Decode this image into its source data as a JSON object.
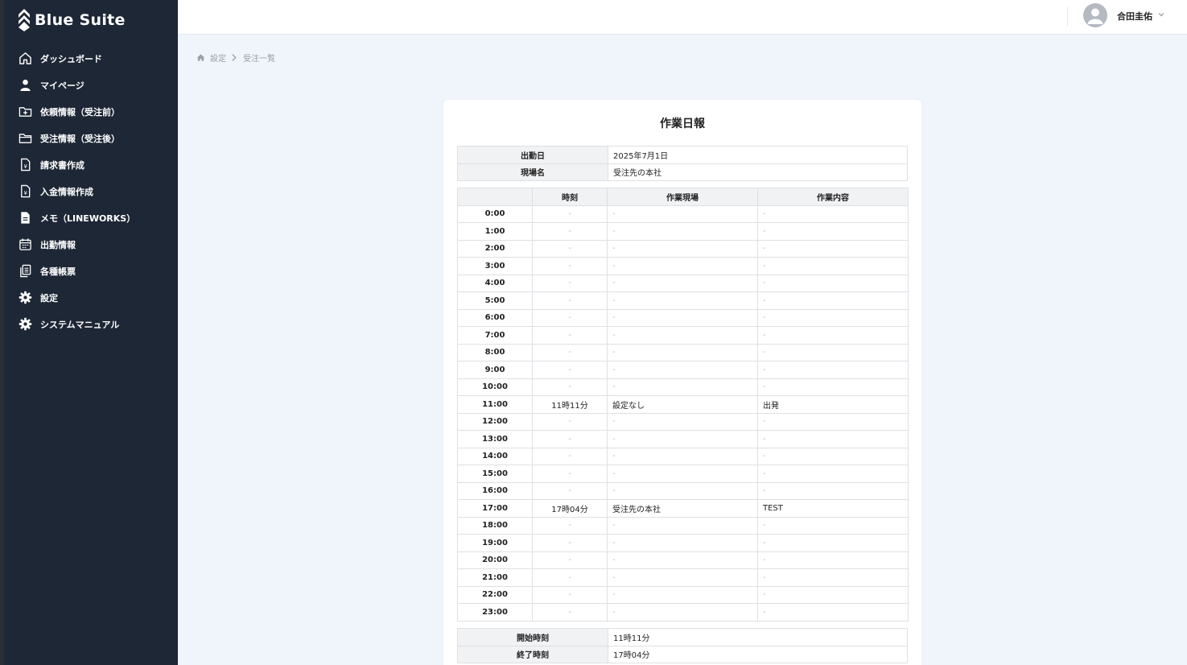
{
  "app": {
    "name": "Blue Suite"
  },
  "sidebar": {
    "items": [
      {
        "label": "ダッシュボード",
        "icon": "home-icon"
      },
      {
        "label": "マイページ",
        "icon": "user-icon"
      },
      {
        "label": "依頼情報（受注前）",
        "icon": "folder-plus-icon"
      },
      {
        "label": "受注情報（受注後）",
        "icon": "folder-icon"
      },
      {
        "label": "請求書作成",
        "icon": "invoice-icon"
      },
      {
        "label": "入金情報作成",
        "icon": "payment-icon"
      },
      {
        "label": "メモ（LINEWORKS）",
        "icon": "document-icon"
      },
      {
        "label": "出勤情報",
        "icon": "calendar-icon"
      },
      {
        "label": "各種帳票",
        "icon": "copy-icon"
      },
      {
        "label": "設定",
        "icon": "gear-icon"
      },
      {
        "label": "システムマニュアル",
        "icon": "gear-icon"
      }
    ]
  },
  "header": {
    "user_name": "合田圭佑"
  },
  "breadcrumb": {
    "items": [
      "設定",
      "受注一覧"
    ]
  },
  "report": {
    "title": "作業日報",
    "info": [
      {
        "label": "出勤日",
        "value": "2025年7月1日"
      },
      {
        "label": "現場名",
        "value": "受注先の本社"
      }
    ],
    "columns": [
      "",
      "時刻",
      "作業現場",
      "作業内容"
    ],
    "rows": [
      {
        "hour": "0:00",
        "time": "-",
        "site": "-",
        "content": "-"
      },
      {
        "hour": "1:00",
        "time": "-",
        "site": "-",
        "content": "-"
      },
      {
        "hour": "2:00",
        "time": "-",
        "site": "-",
        "content": "-"
      },
      {
        "hour": "3:00",
        "time": "-",
        "site": "-",
        "content": "-"
      },
      {
        "hour": "4:00",
        "time": "-",
        "site": "-",
        "content": "-"
      },
      {
        "hour": "5:00",
        "time": "-",
        "site": "-",
        "content": "-"
      },
      {
        "hour": "6:00",
        "time": "-",
        "site": "-",
        "content": "-"
      },
      {
        "hour": "7:00",
        "time": "-",
        "site": "-",
        "content": "-"
      },
      {
        "hour": "8:00",
        "time": "-",
        "site": "-",
        "content": "-"
      },
      {
        "hour": "9:00",
        "time": "-",
        "site": "-",
        "content": "-"
      },
      {
        "hour": "10:00",
        "time": "-",
        "site": "-",
        "content": "-"
      },
      {
        "hour": "11:00",
        "time": "11時11分",
        "site": "設定なし",
        "content": "出発"
      },
      {
        "hour": "12:00",
        "time": "-",
        "site": "-",
        "content": "-"
      },
      {
        "hour": "13:00",
        "time": "-",
        "site": "-",
        "content": "-"
      },
      {
        "hour": "14:00",
        "time": "-",
        "site": "-",
        "content": "-"
      },
      {
        "hour": "15:00",
        "time": "-",
        "site": "-",
        "content": "-"
      },
      {
        "hour": "16:00",
        "time": "-",
        "site": "-",
        "content": "-"
      },
      {
        "hour": "17:00",
        "time": "17時04分",
        "site": "受注先の本社",
        "content": "TEST"
      },
      {
        "hour": "18:00",
        "time": "-",
        "site": "-",
        "content": "-"
      },
      {
        "hour": "19:00",
        "time": "-",
        "site": "-",
        "content": "-"
      },
      {
        "hour": "20:00",
        "time": "-",
        "site": "-",
        "content": "-"
      },
      {
        "hour": "21:00",
        "time": "-",
        "site": "-",
        "content": "-"
      },
      {
        "hour": "22:00",
        "time": "-",
        "site": "-",
        "content": "-"
      },
      {
        "hour": "23:00",
        "time": "-",
        "site": "-",
        "content": "-"
      }
    ],
    "summary": [
      {
        "label": "開始時刻",
        "value": "11時11分"
      },
      {
        "label": "終了時刻",
        "value": "17時04分"
      }
    ]
  }
}
